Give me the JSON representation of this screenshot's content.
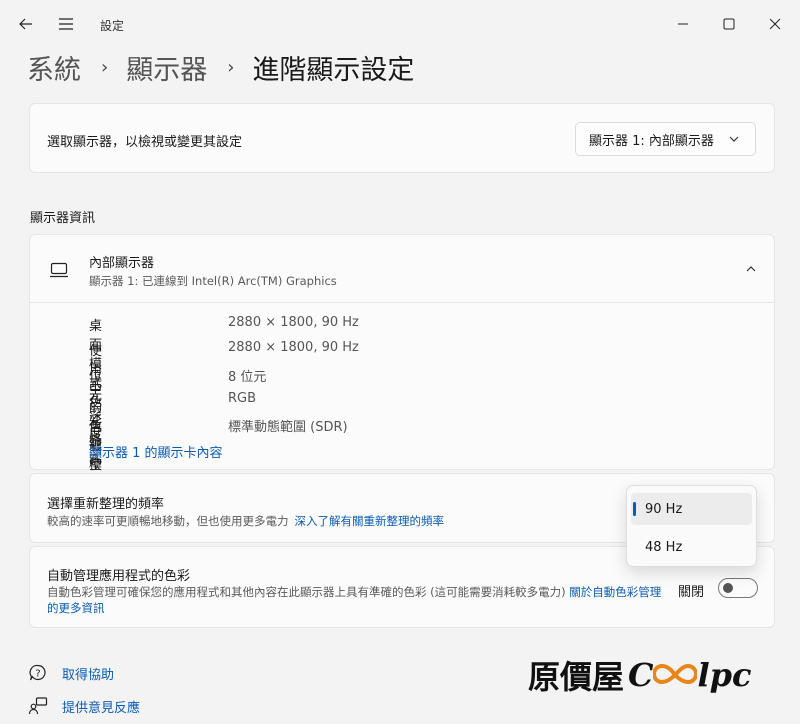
{
  "window": {
    "title": "設定",
    "controls": {
      "minimize": "−",
      "maximize": "□",
      "close": "✕"
    }
  },
  "breadcrumb": {
    "items": [
      "系統",
      "顯示器"
    ],
    "separator": "›",
    "current": "進階顯示設定"
  },
  "display_select": {
    "label": "選取顯示器，以檢視或變更其設定",
    "selected": "顯示器 1: 內部顯示器"
  },
  "display_info": {
    "section_title": "顯示器資訊",
    "name": "內部顯示器",
    "subtitle": "顯示器 1: 已連線到 Intel(R) Arc(TM) Graphics",
    "rows": [
      {
        "key": "桌面模式",
        "value": "2880 × 1800, 90 Hz"
      },
      {
        "key": "使用中的信號模式",
        "value": "2880 × 1800, 90 Hz"
      },
      {
        "key": "位元深度",
        "value": "8 位元"
      },
      {
        "key": "色彩格式",
        "value": "RGB"
      },
      {
        "key": "色彩空間",
        "value": "標準動態範圍 (SDR)"
      }
    ],
    "adapter_link": "顯示器 1 的顯示卡內容"
  },
  "refresh_rate": {
    "title": "選擇重新整理的頻率",
    "description": "較高的速率可更順暢地移動，但也使用更多電力",
    "learn_more": "深入了解有關重新整理的頻率",
    "options": [
      "90 Hz",
      "48 Hz"
    ],
    "selected": "90 Hz"
  },
  "auto_color": {
    "title": "自動管理應用程式的色彩",
    "description": "自動色彩管理可確保您的應用程式和其他內容在此顯示器上具有準確的色彩 (這可能需要消耗較多電力)",
    "link": "關於自動色彩管理的更多資訊",
    "toggle_label": "關閉",
    "toggle_on": false
  },
  "footer": {
    "help": "取得協助",
    "feedback": "提供意見反應"
  },
  "watermark": {
    "text": "原價屋",
    "logo_c": "C",
    "logo_rest": "lpc"
  },
  "colors": {
    "accent": "#0b5bb5",
    "background": "#f3f3f3",
    "card": "#fbfbfb"
  },
  "icons": {
    "back": "back-arrow-icon",
    "menu": "hamburger-menu-icon",
    "monitor": "laptop-monitor-icon",
    "chevron_down": "chevron-down-icon",
    "chevron_up": "chevron-up-icon",
    "help": "help-chat-icon",
    "feedback": "feedback-person-icon"
  }
}
